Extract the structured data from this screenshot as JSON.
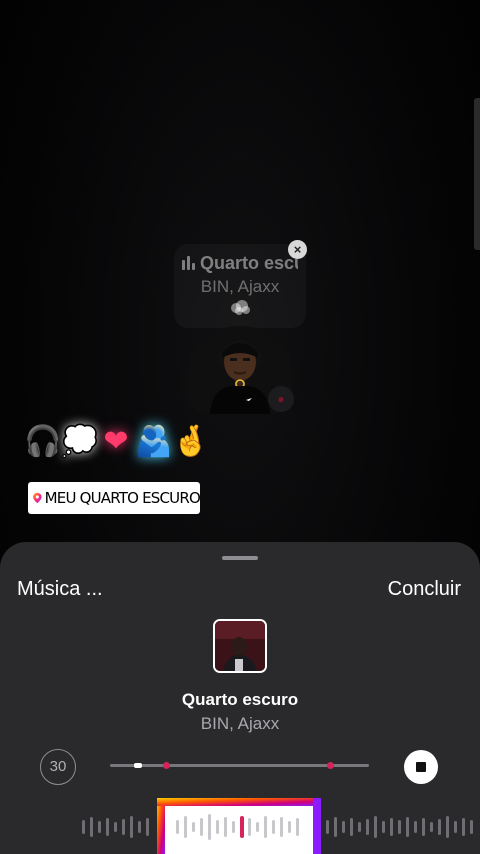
{
  "story": {
    "music_sticker": {
      "title": "Quarto escuro",
      "artist": "BIN, Ajaxx",
      "close_glyph": "×",
      "eq_icon": "equalizer-icon",
      "bubble_icon": "thought-bubble-emoji"
    },
    "emojis": [
      "🎧",
      "💭",
      "❤",
      "🫂",
      "🤞"
    ],
    "location": {
      "icon": "map-pin-icon",
      "text": "MEU QUARTO ESCURO"
    }
  },
  "music_sheet": {
    "title": "Música ...",
    "done_label": "Concluir",
    "song": {
      "title": "Quarto escuro",
      "artist": "BIN, Ajaxx"
    },
    "duration_label": "30",
    "stop_icon": "stop-icon",
    "colors": {
      "sheet_bg": "#2a2a2c",
      "accent_pink": "#d6245a",
      "selector_gradient": [
        "#ffd000",
        "#ff5a00",
        "#d0007a",
        "#8a1cff"
      ]
    }
  }
}
